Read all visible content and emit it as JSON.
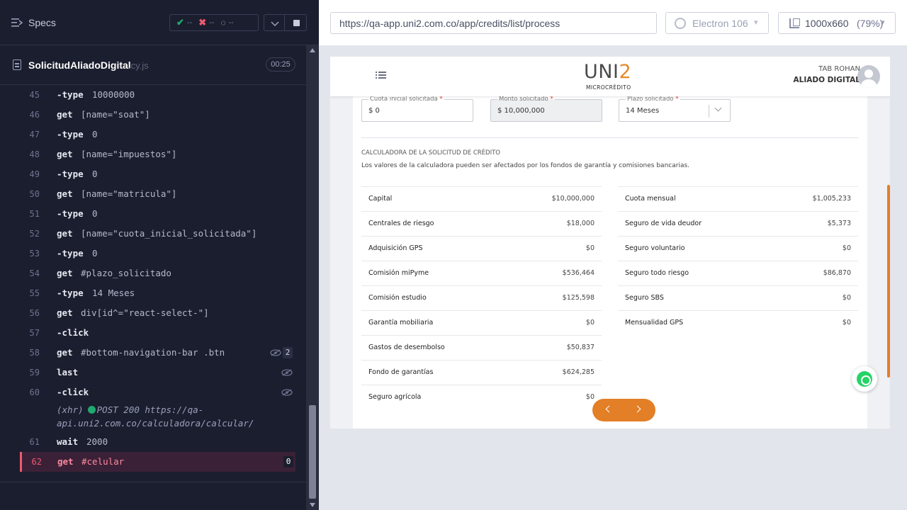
{
  "runner": {
    "title": "Specs",
    "stats": {
      "passed": "--",
      "failed": "--",
      "pending": "--"
    },
    "spec_name": "SolicitudAliadoDigital",
    "spec_ext": ".cy.js",
    "duration": "00:25",
    "commands": [
      {
        "num": "45",
        "name": "-type",
        "msg": "10000000"
      },
      {
        "num": "46",
        "name": "get",
        "msg": "[name=\"soat\"]"
      },
      {
        "num": "47",
        "name": "-type",
        "msg": "0"
      },
      {
        "num": "48",
        "name": "get",
        "msg": "[name=\"impuestos\"]"
      },
      {
        "num": "49",
        "name": "-type",
        "msg": "0"
      },
      {
        "num": "50",
        "name": "get",
        "msg": "[name=\"matricula\"]"
      },
      {
        "num": "51",
        "name": "-type",
        "msg": "0"
      },
      {
        "num": "52",
        "name": "get",
        "msg": "[name=\"cuota_inicial_solicitada\"]"
      },
      {
        "num": "53",
        "name": "-type",
        "msg": "0"
      },
      {
        "num": "54",
        "name": "get",
        "msg": "#plazo_solicitado"
      },
      {
        "num": "55",
        "name": "-type",
        "msg": "14 Meses"
      },
      {
        "num": "56",
        "name": "get",
        "msg": "div[id^=\"react-select-\"]"
      },
      {
        "num": "57",
        "name": "-click",
        "msg": ""
      },
      {
        "num": "58",
        "name": "get",
        "msg": "#bottom-navigation-bar .btn",
        "badge": "2"
      },
      {
        "num": "59",
        "name": "last",
        "msg": ""
      },
      {
        "num": "60",
        "name": "-click",
        "msg": ""
      }
    ],
    "xhr": {
      "prefix": "(xhr)",
      "text": "POST 200 https://qa-api.uni2.com.co/calculadora/calcular/"
    },
    "cmd_61": {
      "num": "61",
      "name": "wait",
      "msg": "2000"
    },
    "cmd_62": {
      "num": "62",
      "name": "get",
      "msg": "#celular",
      "badge": "0"
    }
  },
  "browser": {
    "url": "https://qa-app.uni2.com.co/app/credits/list/process",
    "browser_name": "Electron 106",
    "viewport": "1000x660",
    "zoom": "(79%)"
  },
  "app": {
    "logo_a": "UNI",
    "logo_b": "2",
    "logo_sub": "MICROCRÉDITO",
    "user_name": "TAB ROHAN",
    "user_role": "ALIADO DIGITAL",
    "fields": {
      "cuota": {
        "label": "Cuota inicial solicitada",
        "value": "$ 0"
      },
      "monto": {
        "label": "Monto solicitado",
        "value": "$ 10,000,000"
      },
      "plazo": {
        "label": "Plazo solicitado",
        "value": "14 Meses"
      }
    },
    "calc_title": "CALCULADORA DE LA SOLICITUD DE CRÉDITO",
    "calc_desc": "Los valores de la calculadora pueden ser afectados por los fondos de garantía y comisiones bancarias.",
    "left_rows": [
      {
        "label": "Capital",
        "value": "$10,000,000"
      },
      {
        "label": "Centrales de riesgo",
        "value": "$18,000"
      },
      {
        "label": "Adquisición GPS",
        "value": "$0"
      },
      {
        "label": "Comisión miPyme",
        "value": "$536,464"
      },
      {
        "label": "Comisión estudio",
        "value": "$125,598"
      },
      {
        "label": "Garantía mobiliaria",
        "value": "$0"
      },
      {
        "label": "Gastos de desembolso",
        "value": "$50,837"
      },
      {
        "label": "Fondo de garantías",
        "value": "$624,285"
      },
      {
        "label": "Seguro agrícola",
        "value": "$0"
      }
    ],
    "right_rows": [
      {
        "label": "Cuota mensual",
        "value": "$1,005,233"
      },
      {
        "label": "Seguro de vida deudor",
        "value": "$5,373"
      },
      {
        "label": "Seguro voluntario",
        "value": "$0"
      },
      {
        "label": "Seguro todo riesgo",
        "value": "$86,870"
      },
      {
        "label": "Seguro SBS",
        "value": "$0"
      },
      {
        "label": "Mensualidad GPS",
        "value": "$0"
      }
    ]
  },
  "colors": {
    "accent": "#e37f26",
    "pass": "#1fa971",
    "fail": "#ee5a6f",
    "runner_bg": "#1b1e2e"
  }
}
